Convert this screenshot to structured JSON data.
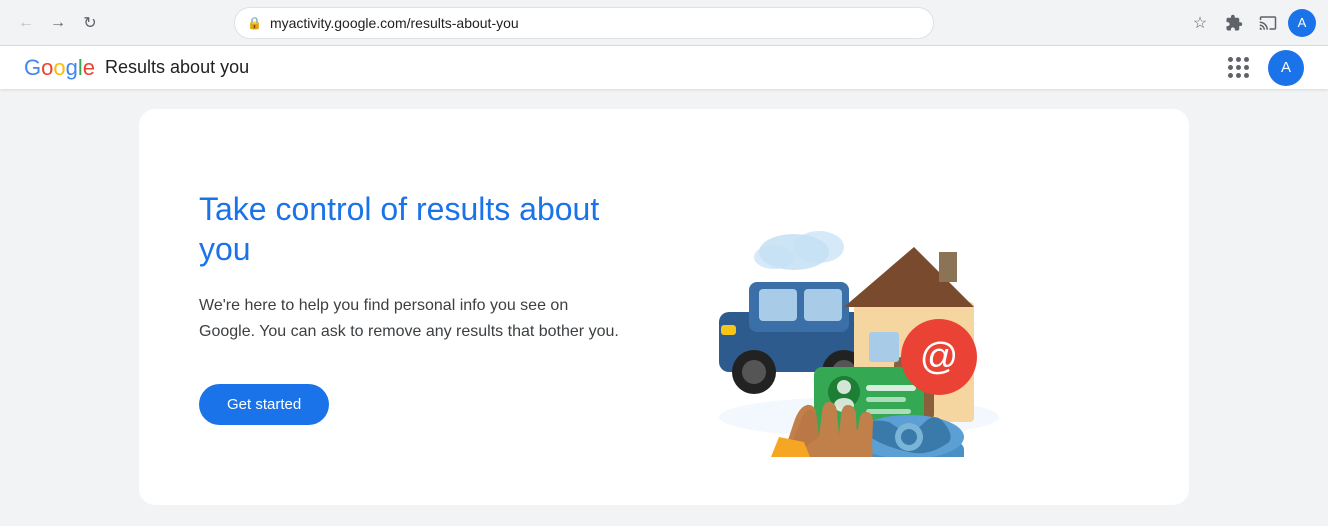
{
  "browser": {
    "url": "myactivity.google.com/results-about-you",
    "profile_letter": "A"
  },
  "nav": {
    "google_logo": "Google",
    "page_title": "Results about you",
    "apps_icon_label": "Google apps",
    "profile_letter": "A"
  },
  "card": {
    "heading": "Take control of results about you",
    "description": "We're here to help you find personal info you see on Google. You can ask to remove any results that bother you.",
    "cta_button": "Get started"
  }
}
